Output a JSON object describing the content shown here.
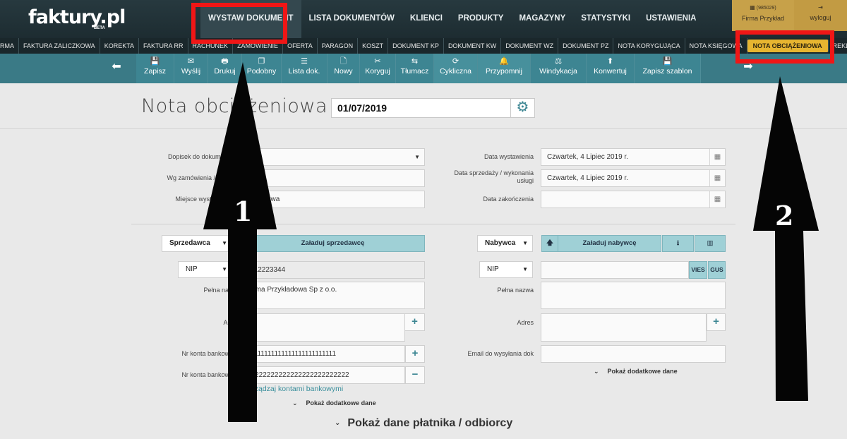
{
  "header": {
    "logo": "faktury.pl",
    "logo_beta": "BETA",
    "nav": [
      "WYSTAW DOKUMENT",
      "LISTA DOKUMENTÓW",
      "KLIENCI",
      "PRODUKTY",
      "MAGAZYNY",
      "STATYSTYKI",
      "USTAWIENIA"
    ],
    "firm_id": "(985029)",
    "firm_name": "Firma Przykład",
    "logout": "wyloguj"
  },
  "doc_types": [
    "RMA",
    "FAKTURA ZALICZKOWA",
    "KOREKTA",
    "FAKTURA RR",
    "RACHUNEK",
    "ZAMÓWIENIE",
    "OFERTA",
    "PARAGON",
    "KOSZT",
    "DOKUMENT KP",
    "DOKUMENT KW",
    "DOKUMENT WZ",
    "DOKUMENT PZ",
    "NOTA KORYGUJĄCA",
    "NOTA KSIĘGOWA",
    "NOTA OBCIĄŻENIOWA",
    "REKLA"
  ],
  "toolbar": {
    "buttons": [
      {
        "label": "Zapisz",
        "icon": "💾"
      },
      {
        "label": "Wyślij",
        "icon": "✉"
      },
      {
        "label": "Drukuj",
        "icon": "🖶"
      },
      {
        "label": "Podobny",
        "icon": "❐"
      },
      {
        "label": "Lista dok.",
        "icon": "☰"
      },
      {
        "label": "Nowy",
        "icon": "🗋"
      },
      {
        "label": "Koryguj",
        "icon": "✂"
      },
      {
        "label": "Tłumacz",
        "icon": "⇆"
      },
      {
        "label": "Cykliczna",
        "icon": "⟳"
      },
      {
        "label": "Przypomnij",
        "icon": "🔔"
      },
      {
        "label": "Windykacja",
        "icon": "⚖"
      },
      {
        "label": "Konwertuj",
        "icon": "⬆"
      },
      {
        "label": "Zapisz szablon",
        "icon": "💾"
      }
    ]
  },
  "document": {
    "title": "Nota obciążeniowa nr",
    "number": "01/07/2019"
  },
  "left_fields": {
    "dopisek_label": "Dopisek do dokumentu",
    "zamowienie_label": "Wg zamówienia / oferty",
    "miejsce_label": "Miejsce wystawienia",
    "miejsce_value": "Warszawa"
  },
  "right_fields": {
    "data_wyst_label": "Data wystawienia",
    "data_wyst_value": "Czwartek, 4 Lipiec 2019 r.",
    "data_sprz_label": "Data sprzedaży / wykonania usługi",
    "data_sprz_value": "Czwartek, 4 Lipiec 2019 r.",
    "data_zak_label": "Data zakończenia"
  },
  "seller": {
    "role": "Sprzedawca",
    "load_button": "Załaduj sprzedawcę",
    "nip_type": "NIP",
    "nip_value": "1112223344",
    "name_label": "Pełna nazwa",
    "name_value": "Firma Przykładowa Sp z o.o.",
    "address_label": "Adres",
    "account1_label": "Nr konta bankowego",
    "account1_value": "11111111111111111111111111",
    "account2_label": "Nr konta bankowego",
    "account2_value": "22222222222222222222222222",
    "manage_link": "Zarządzaj kontami bankowymi",
    "more": "Pokaż dodatkowe dane"
  },
  "buyer": {
    "role": "Nabywca",
    "load_button": "Załaduj nabywcę",
    "nip_type": "NIP",
    "vies": "VIES",
    "gus": "GUS",
    "name_label": "Pełna nazwa",
    "address_label": "Adres",
    "email_label": "Email do wysyłania dok",
    "more": "Pokaż dodatkowe dane"
  },
  "payer_toggle": "Pokaż dane płatnika / odbiorcy",
  "annotations": {
    "arrow1_number": "1",
    "arrow2_number": "2",
    "highlight_color": "#f01616"
  }
}
